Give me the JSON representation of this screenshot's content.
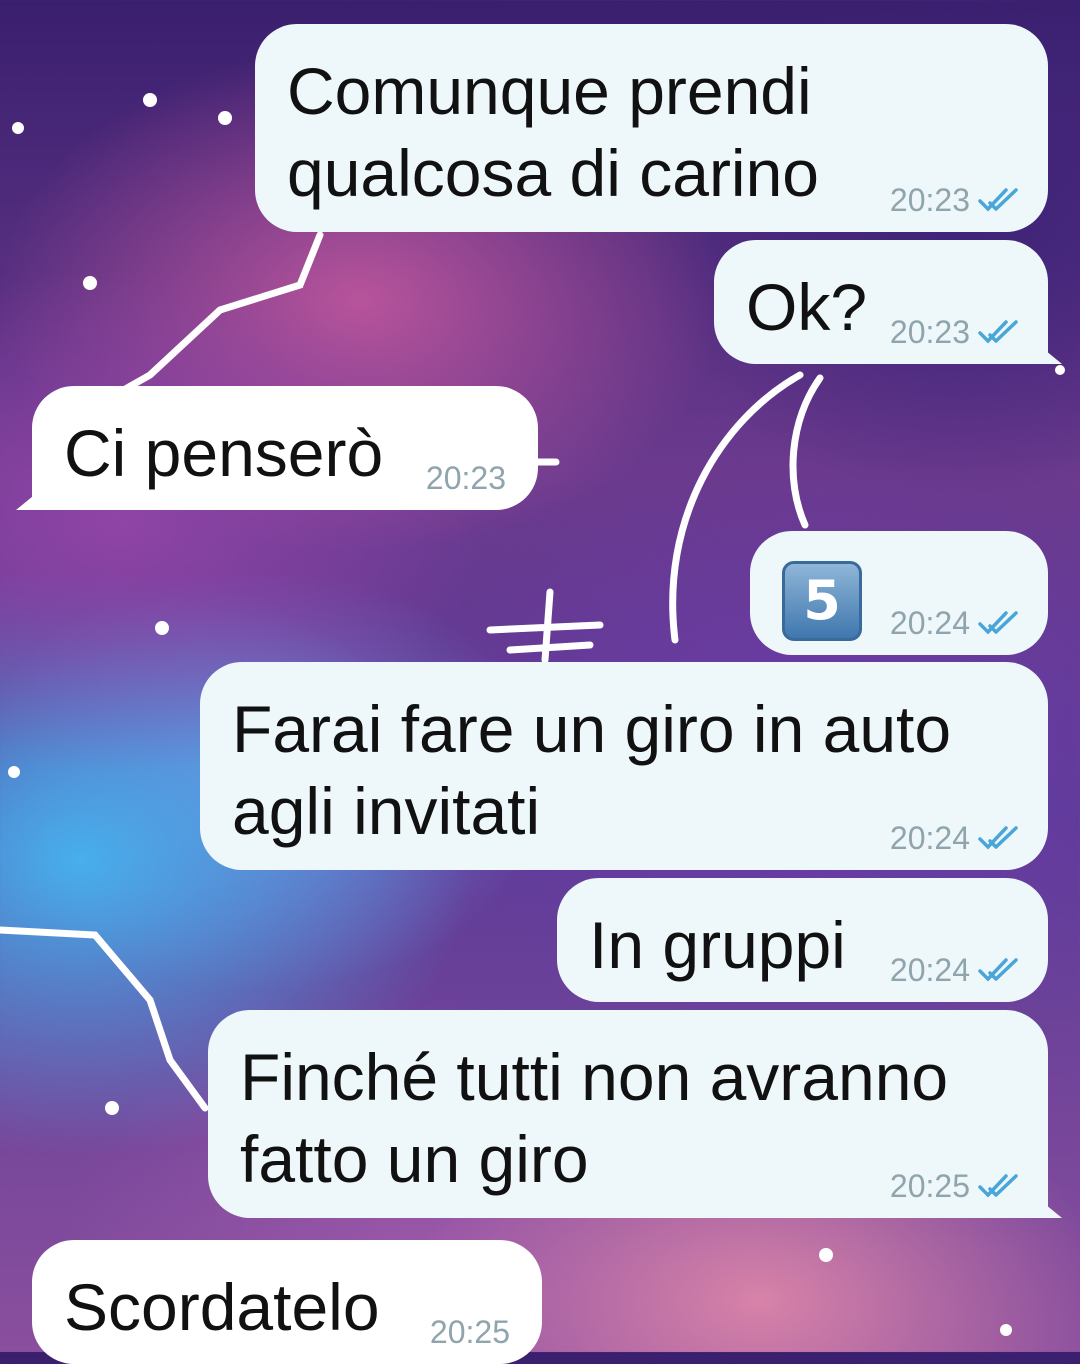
{
  "messages": [
    {
      "dir": "out",
      "text": "Comunque prendi\nqualcosa di carino",
      "time": "20:23",
      "status": "read"
    },
    {
      "dir": "out",
      "text": "Ok?",
      "time": "20:23",
      "status": "read"
    },
    {
      "dir": "in",
      "text": "Ci penserò",
      "time": "20:23"
    },
    {
      "dir": "out",
      "emoji": "5",
      "emoji_name": "keycap-five-icon",
      "time": "20:24",
      "status": "read"
    },
    {
      "dir": "out",
      "text": "Farai fare un giro in auto\nagli invitati",
      "time": "20:24",
      "status": "read"
    },
    {
      "dir": "out",
      "text": "In gruppi",
      "time": "20:24",
      "status": "read"
    },
    {
      "dir": "out",
      "text": "Finché tutti non avranno\nfatto un giro",
      "time": "20:25",
      "status": "read"
    },
    {
      "dir": "in",
      "text": "Scordatelo",
      "time": "20:25"
    }
  ],
  "colors": {
    "outgoing_bubble": "#eef8fb",
    "incoming_bubble": "#ffffff",
    "time_text": "#8fa4ad",
    "read_ticks": "#4aa6d8"
  }
}
